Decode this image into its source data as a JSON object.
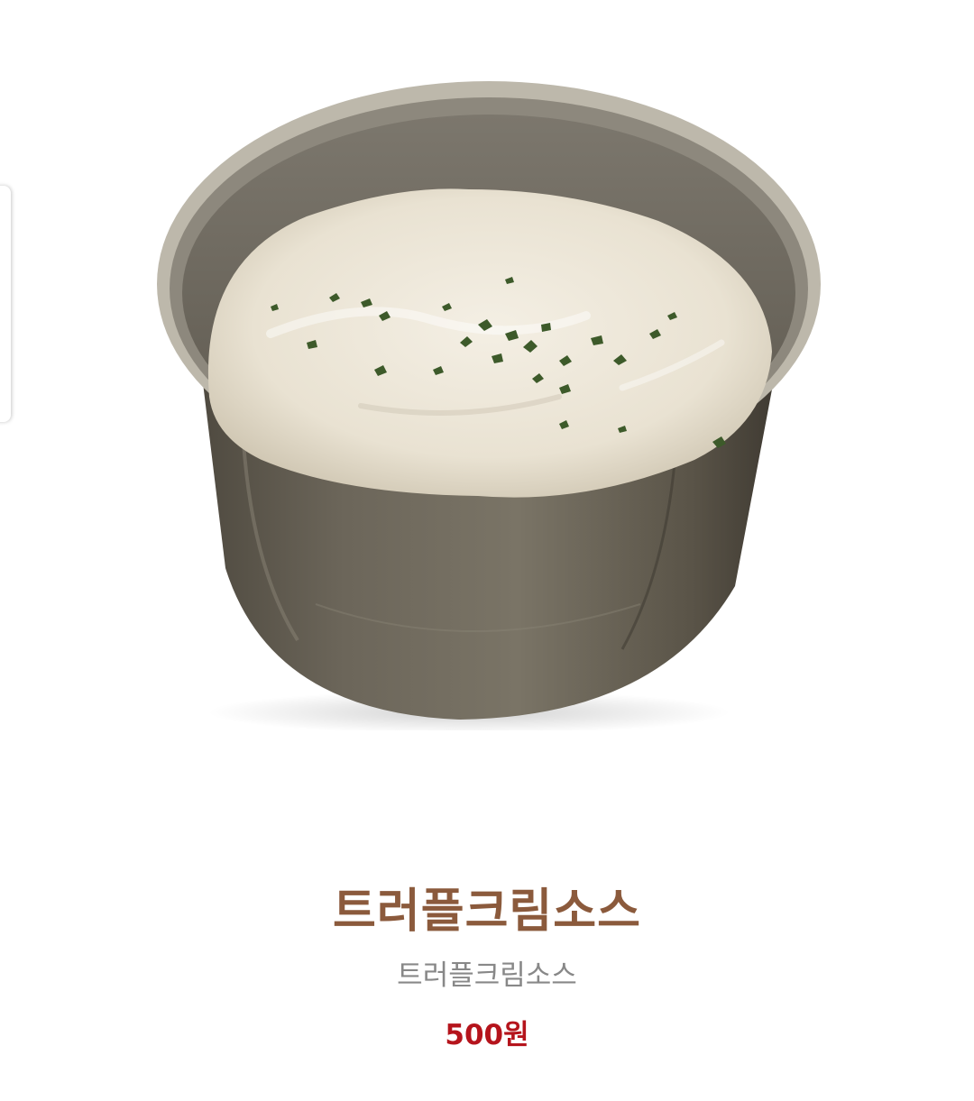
{
  "product": {
    "name": "트러플크림소스",
    "description": "트러플크림소스",
    "price": "500원",
    "image_subject": "truffle cream sauce in metal cup"
  },
  "colors": {
    "name": "#8b5a3c",
    "description": "#888888",
    "price": "#b5141c",
    "background": "#ffffff"
  },
  "icons": {
    "side_tab": "edge-panel-handle"
  }
}
